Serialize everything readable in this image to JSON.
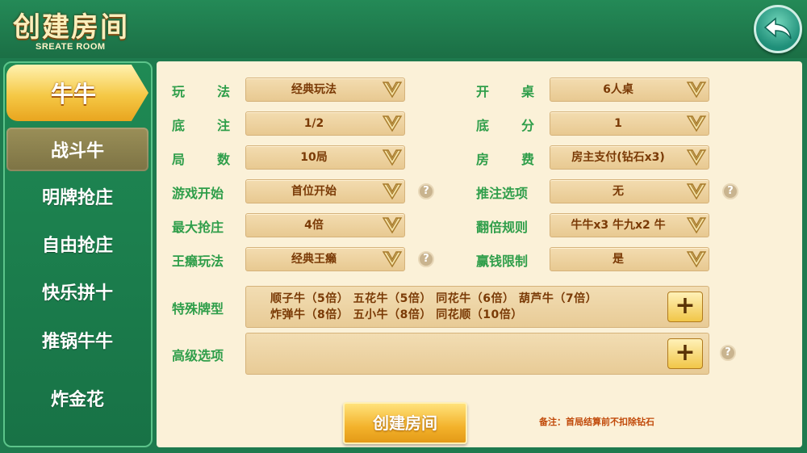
{
  "header": {
    "title": "创建房间",
    "subtitle": "SREATE ROOM"
  },
  "sidebar": {
    "items": [
      {
        "label": "牛牛"
      },
      {
        "label": "战斗牛"
      },
      {
        "label": "明牌抢庄"
      },
      {
        "label": "自由抢庄"
      },
      {
        "label": "快乐拼十"
      },
      {
        "label": "推锅牛牛"
      },
      {
        "label": "炸金花"
      }
    ]
  },
  "form": {
    "left": [
      {
        "label": "玩法",
        "value": "经典玩法"
      },
      {
        "label": "底注",
        "value": "1/2"
      },
      {
        "label": "局数",
        "value": "10局"
      },
      {
        "label": "游戏开始",
        "value": "首位开始"
      },
      {
        "label": "最大抢庄",
        "value": "4倍"
      },
      {
        "label": "王癞玩法",
        "value": "经典王癞"
      }
    ],
    "right": [
      {
        "label": "开桌",
        "value": "6人桌"
      },
      {
        "label": "底分",
        "value": "1"
      },
      {
        "label": "房费",
        "value": "房主支付(钻石x3)"
      },
      {
        "label": "推注选项",
        "value": "无"
      },
      {
        "label": "翻倍规则",
        "value": "牛牛x3 牛九x2 牛"
      },
      {
        "label": "赢钱限制",
        "value": "是"
      }
    ],
    "special": {
      "label": "特殊牌型",
      "line1": "顺子牛（5倍） 五花牛（5倍） 同花牛（6倍） 葫芦牛（7倍）",
      "line2": "炸弹牛（8倍） 五小牛（8倍） 同花顺（10倍）"
    },
    "advanced": {
      "label": "高级选项",
      "value": ""
    },
    "plus_symbol": "+",
    "help_symbol": "?"
  },
  "actions": {
    "create_label": "创建房间"
  },
  "note": "备注：首局结算前不扣除钻石",
  "colors": {
    "label_green": "#2f9e4a",
    "value_brown": "#7a3a06",
    "panel_bg": "#fbf1d8",
    "header_green": "#1e7a4e",
    "gold": "#f3b22b"
  }
}
